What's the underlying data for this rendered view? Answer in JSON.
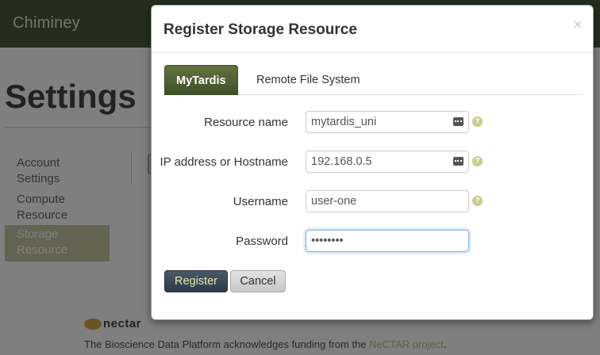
{
  "app": {
    "brand": "Chiminey"
  },
  "page": {
    "title": "Settings",
    "sidebar": [
      {
        "line1": "Account",
        "line2": "Settings",
        "active": false
      },
      {
        "line1": "Compute",
        "line2": "Resource",
        "active": false
      },
      {
        "line1": "Storage",
        "line2": "Resource",
        "active": true
      }
    ],
    "footer": {
      "logo_text": "nectar",
      "text": "The Bioscience Data Platform acknowledges funding from the ",
      "link": "NeCTAR project",
      "suffix": "."
    }
  },
  "modal": {
    "title": "Register Storage Resource",
    "close_label": "×",
    "tabs": [
      {
        "label": "MyTardis",
        "active": true
      },
      {
        "label": "Remote File System",
        "active": false
      }
    ],
    "fields": [
      {
        "label": "Resource name",
        "value": "mytardis_uni",
        "has_icon": true,
        "has_help": true
      },
      {
        "label": "IP address or Hostname",
        "value": "192.168.0.5",
        "has_icon": true,
        "has_help": true
      },
      {
        "label": "Username",
        "value": "user-one",
        "has_icon": false,
        "has_help": true
      },
      {
        "label": "Password",
        "value": "••••••••",
        "has_icon": false,
        "has_help": false,
        "focused": true
      }
    ],
    "help_glyph": "?",
    "buttons": {
      "register": "Register",
      "cancel": "Cancel"
    }
  },
  "colors": {
    "navbar": "#4a5a3a",
    "tab_active": "#4f6030",
    "primary_button": "#34414f",
    "help_icon": "#c9cc8a"
  },
  "icons": {
    "input_icon": "ellipsis-icon",
    "help_icon": "question-icon",
    "close_icon": "close-icon"
  }
}
